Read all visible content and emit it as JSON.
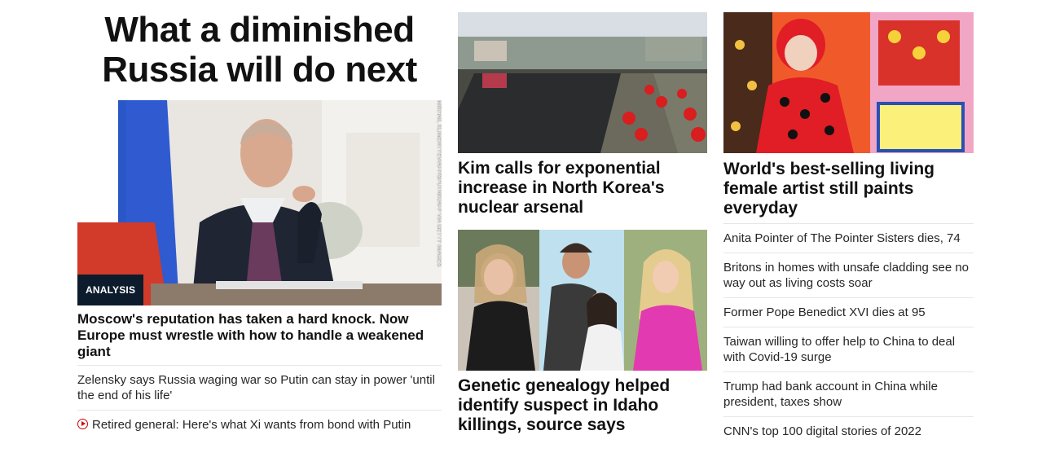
{
  "col1": {
    "headline": "What a diminished Russia will do next",
    "badge": "ANALYSIS",
    "photo_credit": "MIKHAIL KLIMENTYEV/AFP/SPUTNIK/AFP VIA GETTY IMAGES",
    "lead": "Moscow's reputation has taken a hard knock. Now Europe must wrestle with how to handle a weakened giant",
    "links": [
      {
        "text": "Zelensky says Russia waging war so Putin can stay in power 'until the end of his life'",
        "icon": ""
      },
      {
        "text": "Retired general: Here's what Xi wants from bond with Putin",
        "icon": "play-icon"
      }
    ]
  },
  "col2": {
    "story1": "Kim calls for exponential increase in North Korea's nuclear arsenal",
    "story2": "Genetic genealogy helped identify suspect in Idaho killings, source says"
  },
  "col3": {
    "story1": "World's best-selling living female artist still paints everyday",
    "links": [
      "Anita Pointer of The Pointer Sisters dies, 74",
      "Britons in homes with unsafe cladding see no way out as living costs soar",
      "Former Pope Benedict XVI dies at 95",
      "Taiwan willing to offer help to China to deal with Covid-19 surge",
      "Trump had bank account in China while president, taxes show",
      "CNN's top 100 digital stories of 2022"
    ]
  },
  "colors": {
    "badge_bg": "#0c1c2c",
    "play_red": "#cc0000",
    "divider": "#e6e6e6"
  }
}
